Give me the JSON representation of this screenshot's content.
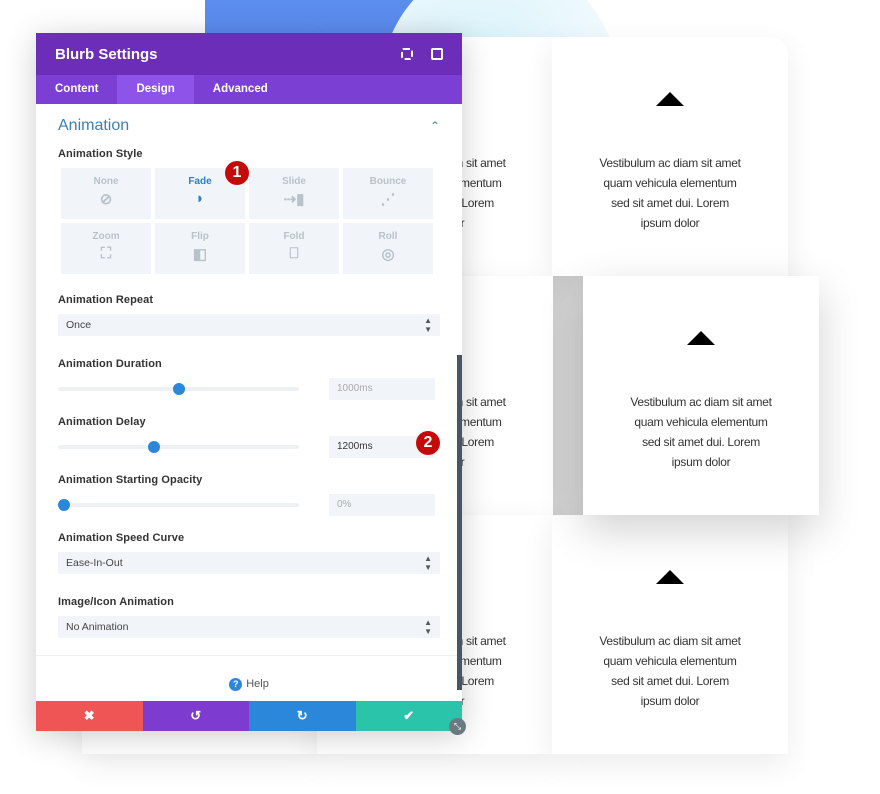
{
  "panel": {
    "title": "Blurb Settings",
    "tabs": [
      {
        "label": "Content"
      },
      {
        "label": "Design"
      },
      {
        "label": "Advanced"
      }
    ],
    "active_tab": "Design",
    "section_title": "Animation",
    "animation_style": {
      "label": "Animation Style",
      "selected": "Fade",
      "options": [
        {
          "label": "None",
          "icon": "⊘"
        },
        {
          "label": "Fade",
          "icon": "◗"
        },
        {
          "label": "Slide",
          "icon": "⇢▮"
        },
        {
          "label": "Bounce",
          "icon": "⋰"
        },
        {
          "label": "Zoom",
          "icon": "⛶"
        },
        {
          "label": "Flip",
          "icon": "◧"
        },
        {
          "label": "Fold",
          "icon": "⎕"
        },
        {
          "label": "Roll",
          "icon": "◎"
        }
      ]
    },
    "repeat": {
      "label": "Animation Repeat",
      "value": "Once"
    },
    "duration": {
      "label": "Animation Duration",
      "value": "1000ms",
      "slider_percent": 50
    },
    "delay": {
      "label": "Animation Delay",
      "value": "1200ms",
      "slider_percent": 40
    },
    "opacity": {
      "label": "Animation Starting Opacity",
      "value": "0%",
      "slider_percent": 0
    },
    "speed_curve": {
      "label": "Animation Speed Curve",
      "value": "Ease-In-Out"
    },
    "icon_animation": {
      "label": "Image/Icon Animation",
      "value": "No Animation"
    },
    "help_label": "Help",
    "footer": {
      "cancel": "✖",
      "undo": "↺",
      "redo": "↻",
      "save": "✔"
    },
    "colors": {
      "header": "#6c2eb9",
      "cancel": "#ef5555",
      "undo": "#7e3bd0",
      "redo": "#2b87da",
      "save": "#29c4a9"
    }
  },
  "badges": [
    "1",
    "2"
  ],
  "card_text": "Vestibulum ac diam sit amet quam vehicula elementum sed sit amet dui. Lorem ipsum dolor",
  "card_lines": [
    "Vestibulum ac diam sit amet",
    "quam vehicula elementum",
    "sed sit amet dui. Lorem",
    "ipsum dolor"
  ]
}
